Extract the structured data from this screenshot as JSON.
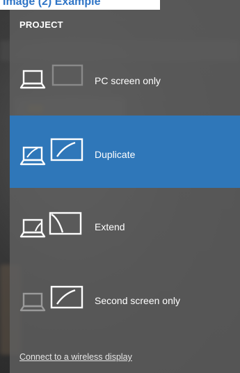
{
  "header": {
    "overflow_text": "Image (2) Example"
  },
  "flyout": {
    "title": "PROJECT",
    "options": [
      {
        "label": "PC screen only",
        "icon": "pc-screen-only-icon"
      },
      {
        "label": "Duplicate",
        "icon": "duplicate-icon",
        "selected": true
      },
      {
        "label": "Extend",
        "icon": "extend-icon"
      },
      {
        "label": "Second screen only",
        "icon": "second-screen-only-icon"
      }
    ],
    "wireless_link": "Connect to a wireless display"
  },
  "colors": {
    "accent": "#2f77b9",
    "panel": "#5f5f5f",
    "text": "#ffffff",
    "dim_icon": "#9a9a9a",
    "heading_blue": "#2e74c6"
  }
}
